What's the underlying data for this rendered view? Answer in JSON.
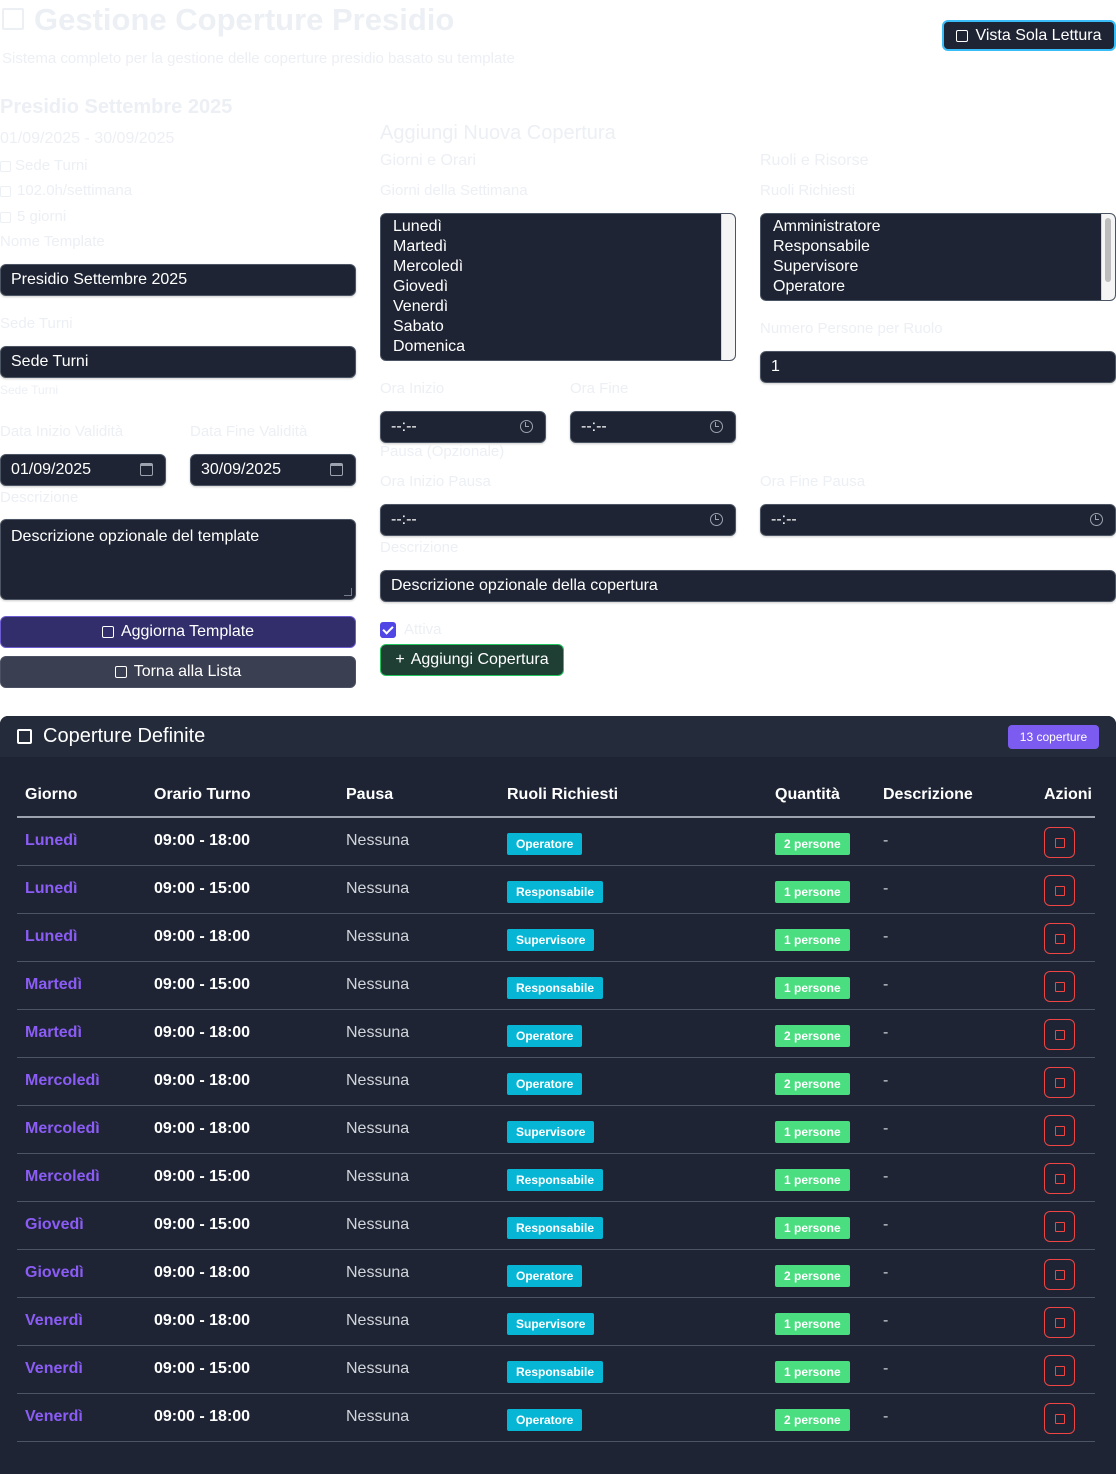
{
  "header": {
    "title": "Gestione Coperture Presidio",
    "subtitle": "Sistema completo per la gestione delle coperture presidio basato su template",
    "readonly_label": "Vista Sola Lettura"
  },
  "template": {
    "name": "Presidio Settembre 2025",
    "period": "01/09/2025 - 30/09/2025",
    "info_location": "Sede Turni",
    "info_hours": "102.0h/settimana",
    "info_days": "5 giorni",
    "name_label": "Nome Template",
    "name_value": "Presidio Settembre 2025",
    "location_label": "Sede Turni",
    "location_value": "Sede Turni",
    "location_hint": "Sede Turni",
    "start_label": "Data Inizio Validità",
    "start_value": "01/09/2025",
    "end_label": "Data Fine Validità",
    "end_value": "30/09/2025",
    "description_label": "Descrizione",
    "description_placeholder": "Descrizione opzionale del template",
    "update_button": "Aggiorna Template",
    "back_button": "Torna alla Lista"
  },
  "new_coverage": {
    "title": "Aggiungi Nuova Copertura",
    "section_days": "Giorni e Orari",
    "section_roles": "Ruoli e Risorse",
    "days_label": "Giorni della Settimana",
    "days": [
      "Lunedì",
      "Martedì",
      "Mercoledì",
      "Giovedì",
      "Venerdì",
      "Sabato",
      "Domenica"
    ],
    "roles_label": "Ruoli Richiesti",
    "roles": [
      "Amministratore",
      "Responsabile",
      "Supervisore",
      "Operatore"
    ],
    "people_label": "Numero Persone per Ruolo",
    "people_value": "1",
    "start_time_label": "Ora Inizio",
    "end_time_label": "Ora Fine",
    "time_placeholder": "--:--",
    "break_title": "Pausa (Opzionale)",
    "break_start_label": "Ora Inizio Pausa",
    "break_end_label": "Ora Fine Pausa",
    "description_label": "Descrizione",
    "description_placeholder": "Descrizione opzionale della copertura",
    "active_label": "Attiva",
    "active_checked": true,
    "add_button": "Aggiungi Copertura",
    "add_icon": "+"
  },
  "coverages": {
    "title": "Coperture Definite",
    "count_badge": "13 coperture",
    "columns": [
      "Giorno",
      "Orario Turno",
      "Pausa",
      "Ruoli Richiesti",
      "Quantità",
      "Descrizione",
      "Azioni"
    ],
    "rows": [
      {
        "day": "Lunedì",
        "time": "09:00 - 18:00",
        "pause": "Nessuna",
        "role": "Operatore",
        "qty": "2 persone",
        "desc": "-"
      },
      {
        "day": "Lunedì",
        "time": "09:00 - 15:00",
        "pause": "Nessuna",
        "role": "Responsabile",
        "qty": "1 persone",
        "desc": "-"
      },
      {
        "day": "Lunedì",
        "time": "09:00 - 18:00",
        "pause": "Nessuna",
        "role": "Supervisore",
        "qty": "1 persone",
        "desc": "-"
      },
      {
        "day": "Martedì",
        "time": "09:00 - 15:00",
        "pause": "Nessuna",
        "role": "Responsabile",
        "qty": "1 persone",
        "desc": "-"
      },
      {
        "day": "Martedì",
        "time": "09:00 - 18:00",
        "pause": "Nessuna",
        "role": "Operatore",
        "qty": "2 persone",
        "desc": "-"
      },
      {
        "day": "Mercoledì",
        "time": "09:00 - 18:00",
        "pause": "Nessuna",
        "role": "Operatore",
        "qty": "2 persone",
        "desc": "-"
      },
      {
        "day": "Mercoledì",
        "time": "09:00 - 18:00",
        "pause": "Nessuna",
        "role": "Supervisore",
        "qty": "1 persone",
        "desc": "-"
      },
      {
        "day": "Mercoledì",
        "time": "09:00 - 15:00",
        "pause": "Nessuna",
        "role": "Responsabile",
        "qty": "1 persone",
        "desc": "-"
      },
      {
        "day": "Giovedì",
        "time": "09:00 - 15:00",
        "pause": "Nessuna",
        "role": "Responsabile",
        "qty": "1 persone",
        "desc": "-"
      },
      {
        "day": "Giovedì",
        "time": "09:00 - 18:00",
        "pause": "Nessuna",
        "role": "Operatore",
        "qty": "2 persone",
        "desc": "-"
      },
      {
        "day": "Venerdì",
        "time": "09:00 - 18:00",
        "pause": "Nessuna",
        "role": "Supervisore",
        "qty": "1 persone",
        "desc": "-"
      },
      {
        "day": "Venerdì",
        "time": "09:00 - 15:00",
        "pause": "Nessuna",
        "role": "Responsabile",
        "qty": "1 persone",
        "desc": "-"
      },
      {
        "day": "Venerdì",
        "time": "09:00 - 18:00",
        "pause": "Nessuna",
        "role": "Operatore",
        "qty": "2 persone",
        "desc": "-"
      }
    ]
  },
  "colors": {
    "panel_dark": "#1e2433",
    "accent_purple": "#7c5cf0",
    "role_badge": "#06b6d4",
    "qty_badge": "#4ade80",
    "danger": "#ef4444"
  }
}
